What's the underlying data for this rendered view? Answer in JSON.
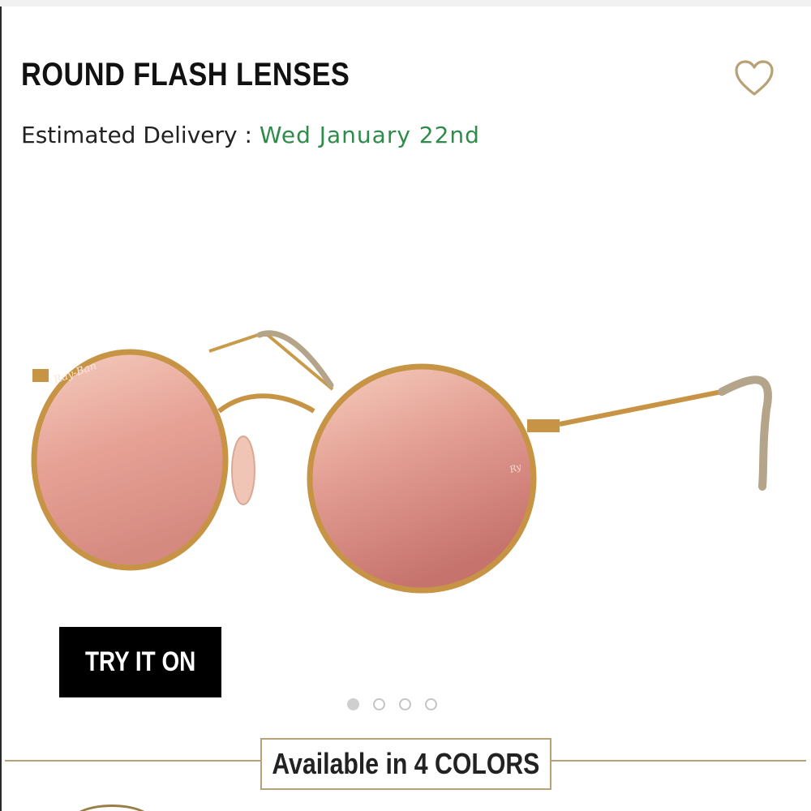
{
  "product": {
    "title": "ROUND FLASH LENSES",
    "delivery_label": "Estimated Delivery : ",
    "delivery_date": "Wed January 22nd"
  },
  "wishlist": {
    "icon": "heart-outline-icon"
  },
  "image": {
    "brand_mark": "Ray-Ban"
  },
  "actions": {
    "try_on_label": "TRY IT ON"
  },
  "carousel": {
    "total": 4,
    "active_index": 0
  },
  "colors": {
    "label": "Available in 4 COLORS"
  },
  "theme": {
    "accent_gold": "#b8a077",
    "delivery_green": "#2e8b4a"
  }
}
